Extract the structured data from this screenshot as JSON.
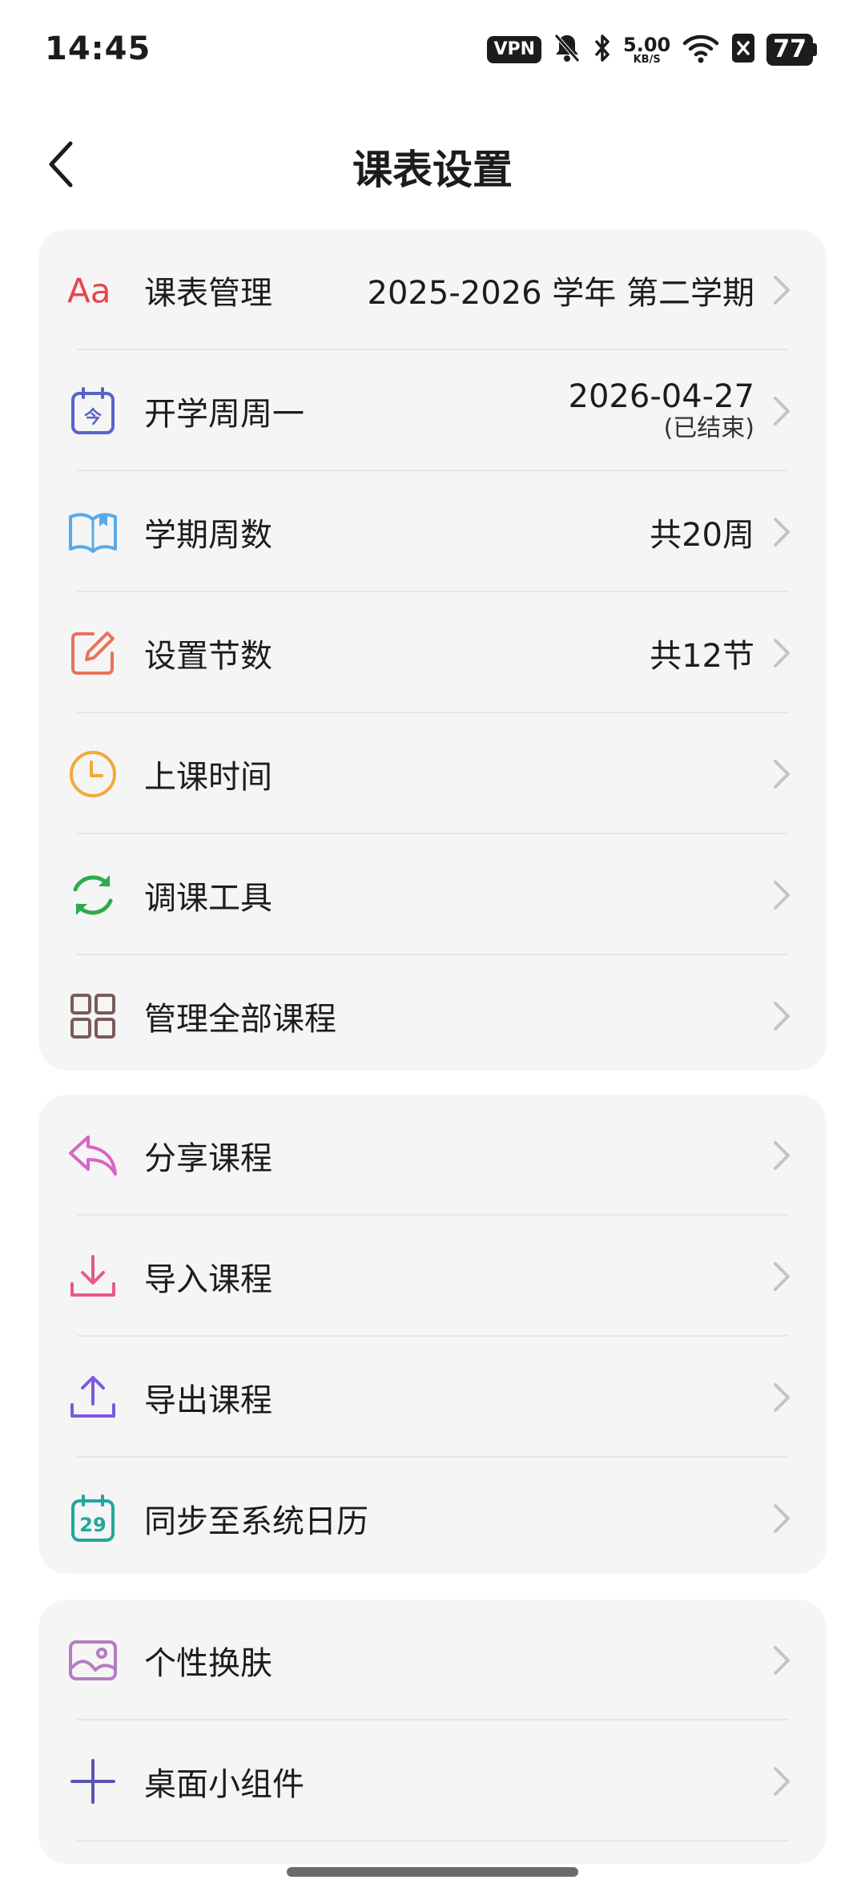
{
  "status": {
    "time": "14:45",
    "vpn": "VPN",
    "speed_value": "5.00",
    "speed_unit": "KB/S",
    "battery": "77"
  },
  "header": {
    "title": "课表设置"
  },
  "sections": [
    {
      "items": [
        {
          "icon": "font-aa-icon",
          "label": "课表管理",
          "value": "2025-2026 学年 第二学期"
        },
        {
          "icon": "calendar-today-icon",
          "label": "开学周周一",
          "value": "2026-04-27",
          "sub": "(已结束)"
        },
        {
          "icon": "book-icon",
          "label": "学期周数",
          "value": "共20周"
        },
        {
          "icon": "edit-icon",
          "label": "设置节数",
          "value": "共12节"
        },
        {
          "icon": "clock-icon",
          "label": "上课时间",
          "value": ""
        },
        {
          "icon": "refresh-icon",
          "label": "调课工具",
          "value": ""
        },
        {
          "icon": "grid-icon",
          "label": "管理全部课程",
          "value": ""
        }
      ]
    },
    {
      "items": [
        {
          "icon": "share-icon",
          "label": "分享课程"
        },
        {
          "icon": "download-icon",
          "label": "导入课程"
        },
        {
          "icon": "upload-icon",
          "label": "导出课程"
        },
        {
          "icon": "calendar-29-icon",
          "label": "同步至系统日历",
          "calendar_day": "29"
        }
      ]
    },
    {
      "items": [
        {
          "icon": "image-icon",
          "label": "个性换肤"
        },
        {
          "icon": "plus-icon",
          "label": "桌面小组件"
        }
      ]
    }
  ],
  "colors": {
    "font_icon": "#e8454f",
    "calendar": "#5b63c9",
    "book": "#5aa9e6",
    "edit": "#e8735a",
    "clock": "#f2a93b",
    "refresh": "#2eab4c",
    "grid": "#7a5a5a",
    "share": "#d764c9",
    "download": "#e8578f",
    "upload": "#7d5ae0",
    "calendar29": "#20a89a",
    "image": "#b57cc1",
    "plus": "#5b55b5"
  }
}
